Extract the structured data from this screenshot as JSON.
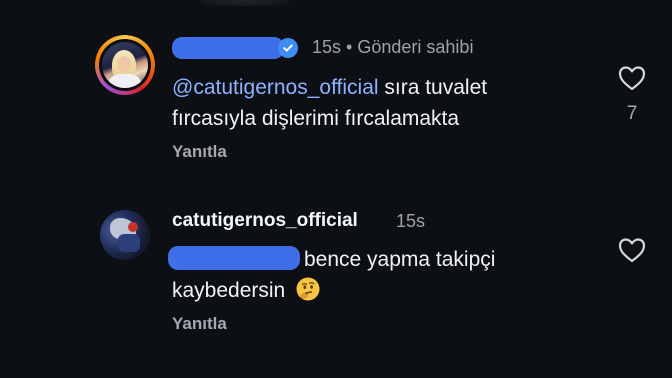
{
  "comments": [
    {
      "username_hidden": true,
      "verified": true,
      "time": "15s",
      "separator": "•",
      "author_badge": "Gönderi sahibi",
      "mention": "@catutigernos_official",
      "text_after_mention_line1": " sıra tuvalet",
      "text_line2": "fırcasıyla dişlerimi fırcalamakta",
      "reply_label": "Yanıtla",
      "like_count": "7",
      "avatar": "profile-photo-with-story-ring"
    },
    {
      "username": "catutigernos_official",
      "time": "15s",
      "mention_hidden": true,
      "text_after_mention_line1": "bence yapma takipçi",
      "text_line2": "kaybedersin",
      "emoji": "thinking-face",
      "reply_label": "Yanıtla",
      "avatar": "profile-photo"
    }
  ],
  "colors": {
    "background": "#0c0f14",
    "mention": "#8fb2ff",
    "redaction": "#3f6fe8",
    "verified": "#3d8df5",
    "secondary_text": "#9ea3ab"
  }
}
